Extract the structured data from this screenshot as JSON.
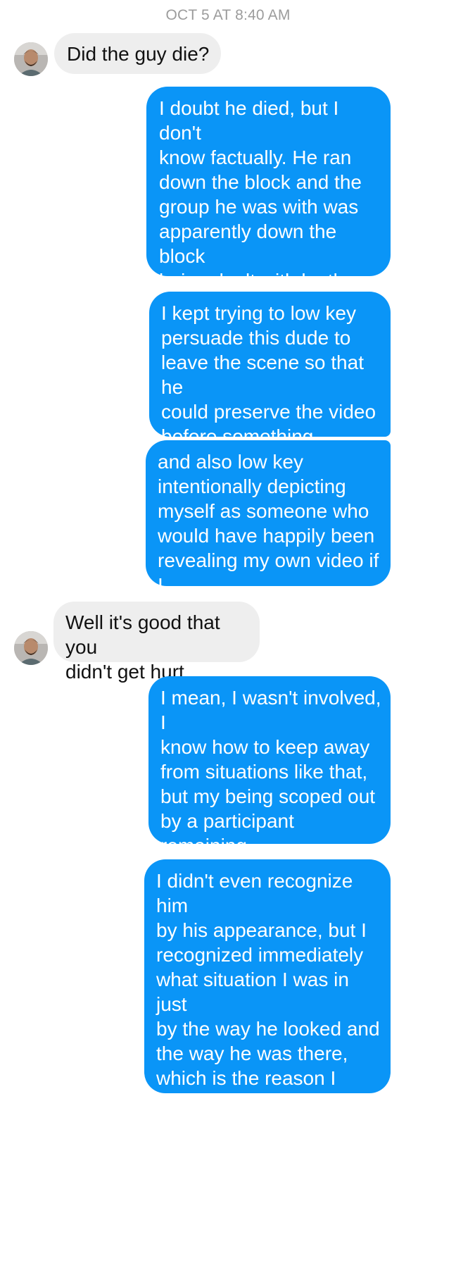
{
  "conversation": {
    "timestamp": "OCT 5 AT 8:40 AM",
    "messages": [
      {
        "sender": "contact",
        "text": "Did the guy die?"
      },
      {
        "sender": "me",
        "text": "I doubt he died, but I don't\nknow factually. He ran\ndown the block and the\ngroup he was with was\napparently down the block\nbeing dealt with by the\npolice, but I didn't go that\nfar down the block"
      },
      {
        "sender": "me",
        "text": "I kept trying to low key\npersuade this dude to\nleave the scene so that he\ncould preserve the video\nbefore something\nhappened to it"
      },
      {
        "sender": "me",
        "text": "and also low key\nintentionally depicting\nmyself as someone who\nwould have happily been\nrevealing my own video if I\nhad any"
      },
      {
        "sender": "contact",
        "text": "Well it's good that you\ndidn't get hurt."
      },
      {
        "sender": "me",
        "text": "I mean, I wasn't involved, I\nknow how to keep away\nfrom situations like that,\nbut my being scoped out\nby a participant remaining\nat the scene was pretty\nnew and weird"
      },
      {
        "sender": "me",
        "text": "I didn't even recognize him\nby his appearance, but I\nrecognized immediately\nwhat situation I was in just\nby the way he looked and\nthe way he was there,\nwhich is the reason I didn't\njust dip into an alley and\nwait for my sleep spot to\nclear out"
      }
    ]
  },
  "colors": {
    "outgoing_bubble": "#0a95f7",
    "incoming_bubble": "#eeeeee",
    "timestamp_text": "#9c9c9c"
  },
  "icons": {
    "contact_avatar": "contact-avatar-icon"
  }
}
